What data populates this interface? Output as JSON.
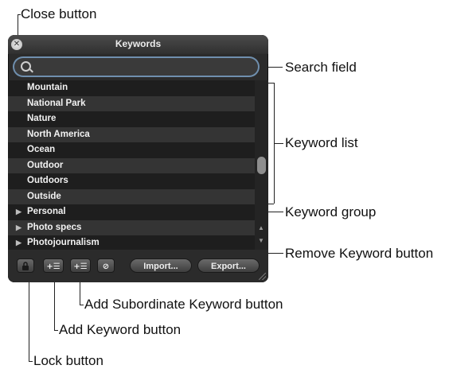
{
  "callouts": {
    "close": "Close button",
    "search": "Search field",
    "keyword_list": "Keyword list",
    "keyword_group": "Keyword group",
    "remove": "Remove Keyword button",
    "add_subordinate": "Add Subordinate Keyword button",
    "add_keyword": "Add Keyword button",
    "lock": "Lock button"
  },
  "window": {
    "title": "Keywords",
    "close_glyph": "✕",
    "search": {
      "value": "",
      "placeholder": ""
    }
  },
  "keywords": [
    {
      "label": "Mountain",
      "group": false
    },
    {
      "label": "National Park",
      "group": false
    },
    {
      "label": "Nature",
      "group": false
    },
    {
      "label": "North America",
      "group": false
    },
    {
      "label": "Ocean",
      "group": false
    },
    {
      "label": "Outdoor",
      "group": false
    },
    {
      "label": "Outdoors",
      "group": false
    },
    {
      "label": "Outside",
      "group": false
    },
    {
      "label": "Personal",
      "group": true
    },
    {
      "label": "Photo specs",
      "group": true
    },
    {
      "label": "Photojournalism",
      "group": true
    }
  ],
  "buttons": {
    "lock_icon": "lock-icon",
    "add_keyword_glyph": "+☰",
    "add_subordinate_glyph": "+☰",
    "remove_glyph": "⊘",
    "import": "Import...",
    "export": "Export..."
  },
  "colors": {
    "hud_bg": "#2b2b2b",
    "search_focus": "#6f8fae",
    "row_dark": "#1e1e1e",
    "row_light": "#343434"
  }
}
